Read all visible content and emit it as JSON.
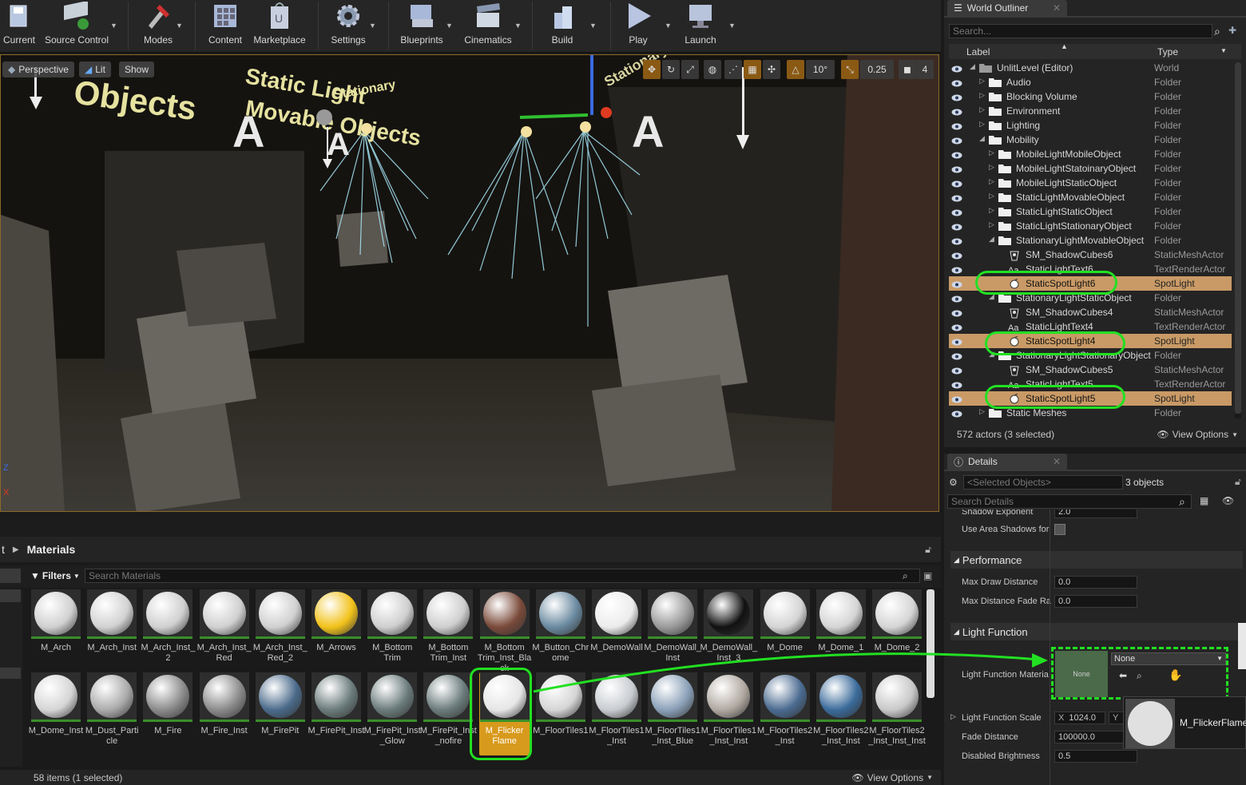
{
  "toolbar": {
    "buttons": [
      {
        "label": "Current"
      },
      {
        "label": "Source Control"
      },
      {
        "label": "Modes"
      },
      {
        "label": "Content"
      },
      {
        "label": "Marketplace"
      },
      {
        "label": "Settings"
      },
      {
        "label": "Blueprints"
      },
      {
        "label": "Cinematics"
      },
      {
        "label": "Build"
      },
      {
        "label": "Play"
      },
      {
        "label": "Launch"
      }
    ]
  },
  "viewport": {
    "perspective": "Perspective",
    "lit": "Lit",
    "show": "Show",
    "rotation_snap": "10°",
    "scale_snap": "0.25",
    "camera_speed": "4",
    "axis_z": "Z",
    "axis_x": "X",
    "scene_text": [
      "Objects",
      "Static Light",
      "Movable Objects",
      "Stationary",
      "Stationary Objects"
    ],
    "billboard_letter": "A"
  },
  "content_browser": {
    "breadcrumb_prev": "t",
    "folder": "Materials",
    "filters": "Filters",
    "search_placeholder": "Search Materials",
    "status": "58 items (1 selected)",
    "view_options": "View Options",
    "row1": [
      {
        "name": "M_Arch",
        "color": "#d0d0d0"
      },
      {
        "name": "M_Arch_Inst",
        "color": "#d2d2d2"
      },
      {
        "name": "M_Arch_Inst_2",
        "color": "#d0d0d0"
      },
      {
        "name": "M_Arch_Inst_Red",
        "color": "#d0d0d0"
      },
      {
        "name": "M_Arch_Inst_Red_2",
        "color": "#d0d0d0"
      },
      {
        "name": "M_Arrows",
        "color": "#f2c21a"
      },
      {
        "name": "M_Bottom Trim",
        "color": "#cfcfcf"
      },
      {
        "name": "M_Bottom Trim_Inst",
        "color": "#cfcfcf"
      },
      {
        "name": "M_Bottom Trim_Inst_Black",
        "color": "#7a4a3a"
      },
      {
        "name": "M_Button_Chrome",
        "color": "#6a8aa0"
      },
      {
        "name": "M_DemoWall",
        "color": "#ececec"
      },
      {
        "name": "M_DemoWall_Inst",
        "color": "#9a9a9a"
      },
      {
        "name": "M_DemoWall_Inst_3",
        "color": "#111111"
      },
      {
        "name": "M_Dome",
        "color": "#d5d5d5"
      },
      {
        "name": "M_Dome_1",
        "color": "#d5d5d5"
      },
      {
        "name": "M_Dome_2",
        "color": "#d5d5d5"
      }
    ],
    "row2": [
      {
        "name": "M_Dome_Inst",
        "color": "#d5d5d5"
      },
      {
        "name": "M_Dust_Particle",
        "color": "#aaaaaa"
      },
      {
        "name": "M_Fire",
        "color": "#8a8a8a"
      },
      {
        "name": "M_Fire_Inst",
        "color": "#8a8a8a"
      },
      {
        "name": "M_FirePit",
        "color": "#4a6a8a"
      },
      {
        "name": "M_FirePit_Inst",
        "color": "#6a7a7a"
      },
      {
        "name": "M_FirePit_Inst_Glow",
        "color": "#6a7a7a"
      },
      {
        "name": "M_FirePit_Inst_nofire",
        "color": "#6a7a7a"
      },
      {
        "name": "M_Flicker Flame",
        "color": "#e6e6e6"
      },
      {
        "name": "M_FloorTiles1",
        "color": "#d5d5d5"
      },
      {
        "name": "M_FloorTiles1_Inst",
        "color": "#c8ccd0"
      },
      {
        "name": "M_FloorTiles1_Inst_Blue",
        "color": "#8aa0b8"
      },
      {
        "name": "M_FloorTiles1_Inst_Inst",
        "color": "#b0a8a0"
      },
      {
        "name": "M_FloorTiles2_Inst",
        "color": "#4a6a90"
      },
      {
        "name": "M_FloorTiles2_Inst_Inst",
        "color": "#3a6a9a"
      },
      {
        "name": "M_FloorTiles2_Inst_Inst_Inst",
        "color": "#c8c8c8"
      }
    ]
  },
  "outliner": {
    "tab": "World Outliner",
    "search_placeholder": "Search...",
    "col_label": "Label",
    "col_type": "Type",
    "rows": [
      {
        "label": "UnlitLevel (Editor)",
        "type": "World",
        "indent": 0,
        "kind": "world",
        "sel": false
      },
      {
        "label": "Audio",
        "type": "Folder",
        "indent": 1,
        "kind": "folder",
        "sel": false
      },
      {
        "label": "Blocking Volume",
        "type": "Folder",
        "indent": 1,
        "kind": "folder",
        "sel": false
      },
      {
        "label": "Environment",
        "type": "Folder",
        "indent": 1,
        "kind": "folder",
        "sel": false
      },
      {
        "label": "Lighting",
        "type": "Folder",
        "indent": 1,
        "kind": "folder",
        "sel": false
      },
      {
        "label": "Mobility",
        "type": "Folder",
        "indent": 1,
        "kind": "folder-open",
        "sel": false
      },
      {
        "label": "MobileLightMobileObject",
        "type": "Folder",
        "indent": 2,
        "kind": "folder",
        "sel": false
      },
      {
        "label": "MobileLightStatoinaryObject",
        "type": "Folder",
        "indent": 2,
        "kind": "folder",
        "sel": false
      },
      {
        "label": "MobileLightStaticObject",
        "type": "Folder",
        "indent": 2,
        "kind": "folder",
        "sel": false
      },
      {
        "label": "StaticLightMovableObject",
        "type": "Folder",
        "indent": 2,
        "kind": "folder",
        "sel": false
      },
      {
        "label": "StaticLightStaticObject",
        "type": "Folder",
        "indent": 2,
        "kind": "folder",
        "sel": false
      },
      {
        "label": "StaticLightStationaryObject",
        "type": "Folder",
        "indent": 2,
        "kind": "folder",
        "sel": false
      },
      {
        "label": "StationaryLightMovableObject",
        "type": "Folder",
        "indent": 2,
        "kind": "folder-open",
        "sel": false
      },
      {
        "label": "SM_ShadowCubes6",
        "type": "StaticMeshActor",
        "indent": 3,
        "kind": "mesh",
        "sel": false
      },
      {
        "label": "StaticLightText6",
        "type": "TextRenderActor",
        "indent": 3,
        "kind": "text",
        "sel": false
      },
      {
        "label": "StaticSpotLight6",
        "type": "SpotLight",
        "indent": 3,
        "kind": "light",
        "sel": true
      },
      {
        "label": "StationaryLightStaticObject",
        "type": "Folder",
        "indent": 2,
        "kind": "folder-open",
        "sel": false
      },
      {
        "label": "SM_ShadowCubes4",
        "type": "StaticMeshActor",
        "indent": 3,
        "kind": "mesh",
        "sel": false
      },
      {
        "label": "StaticLightText4",
        "type": "TextRenderActor",
        "indent": 3,
        "kind": "text",
        "sel": false
      },
      {
        "label": "StaticSpotLight4",
        "type": "SpotLight",
        "indent": 3,
        "kind": "light",
        "sel": true
      },
      {
        "label": "StationaryLightStationaryObject",
        "type": "Folder",
        "indent": 2,
        "kind": "folder-open",
        "sel": false
      },
      {
        "label": "SM_ShadowCubes5",
        "type": "StaticMeshActor",
        "indent": 3,
        "kind": "mesh",
        "sel": false
      },
      {
        "label": "StaticLightText5",
        "type": "TextRenderActor",
        "indent": 3,
        "kind": "text",
        "sel": false
      },
      {
        "label": "StaticSpotLight5",
        "type": "SpotLight",
        "indent": 3,
        "kind": "light",
        "sel": true
      },
      {
        "label": "Static Meshes",
        "type": "Folder",
        "indent": 1,
        "kind": "folder",
        "sel": false
      }
    ],
    "footer_count": "572 actors (3 selected)",
    "view_options": "View Options"
  },
  "details": {
    "tab": "Details",
    "selected_placeholder": "<Selected Objects>",
    "objects_count": "3 objects",
    "search_placeholder": "Search Details",
    "shadow_exponent_label": "Shadow Exponent",
    "shadow_exponent_value": "2.0",
    "use_area_shadows": "Use Area Shadows for",
    "performance": "Performance",
    "max_draw_distance": "Max Draw Distance",
    "max_draw_distance_value": "0.0",
    "max_distance_fade": "Max Distance Fade Ra",
    "max_distance_fade_value": "0.0",
    "light_function": "Light Function",
    "light_function_material": "Light Function Materia",
    "thumb_none": "None",
    "material_select": "None",
    "light_function_scale": "Light Function Scale",
    "scale_x_label": "X",
    "scale_x": "1024.0",
    "scale_y_label": "Y",
    "fade_distance": "Fade Distance",
    "fade_distance_value": "100000.0",
    "disabled_brightness": "Disabled Brightness",
    "disabled_brightness_value": "0.5",
    "drag_tooltip": "M_FlickerFlame"
  },
  "colors": {
    "accent_green": "#22e022",
    "selection_orange": "#d89a1c",
    "outliner_selection": "#c99a66"
  }
}
